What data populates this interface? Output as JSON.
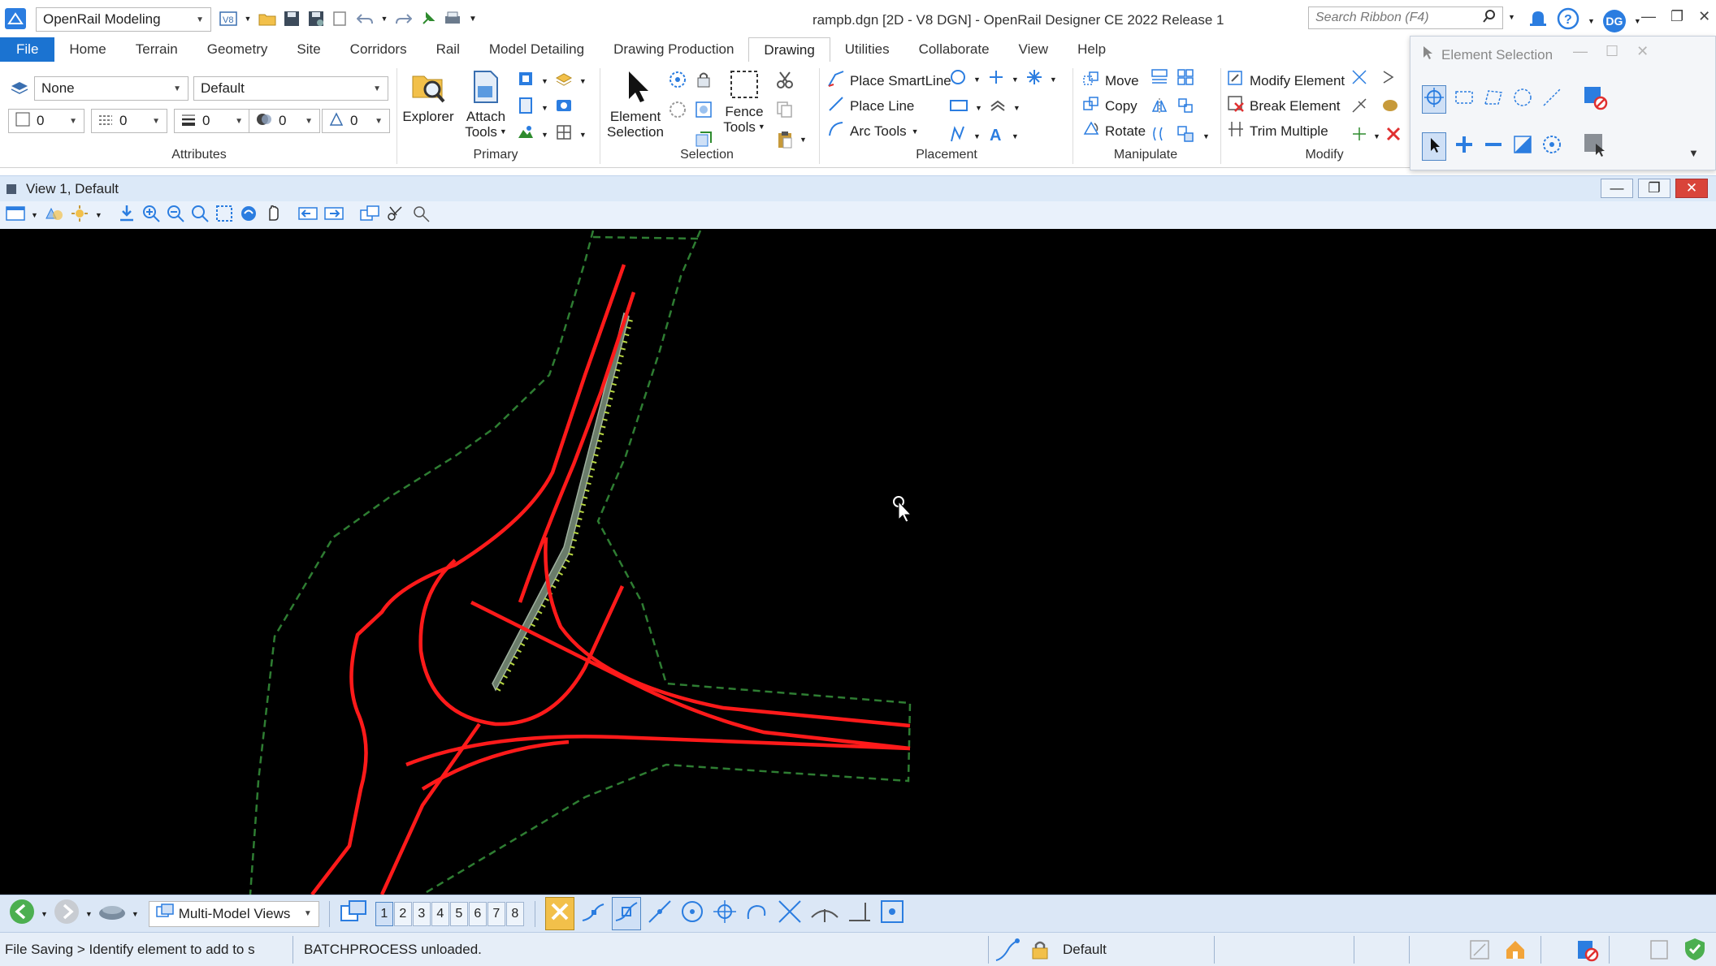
{
  "titlebar": {
    "workflow": "OpenRail Modeling",
    "title": "rampb.dgn [2D - V8 DGN] - OpenRail Designer CE 2022 Release 1",
    "search_placeholder": "Search Ribbon (F4)",
    "user_initials": "DG"
  },
  "tabs": [
    "File",
    "Home",
    "Terrain",
    "Geometry",
    "Site",
    "Corridors",
    "Rail",
    "Model Detailing",
    "Drawing Production",
    "Drawing",
    "Utilities",
    "Collaborate",
    "View",
    "Help"
  ],
  "active_tab": "Drawing",
  "ribbon": {
    "attributes": {
      "level": "None",
      "style": "Default",
      "color": "0",
      "line_style": "0",
      "weight": "0",
      "transparency": "0",
      "priority": "0",
      "label": "Attributes"
    },
    "primary": {
      "explorer": "Explorer",
      "attach_tools_1": "Attach",
      "attach_tools_2": "Tools",
      "label": "Primary"
    },
    "selection": {
      "element_selection_1": "Element",
      "element_selection_2": "Selection",
      "fence_tools_1": "Fence",
      "fence_tools_2": "Tools",
      "label": "Selection"
    },
    "placement": {
      "smartline": "Place SmartLine",
      "line": "Place Line",
      "arc": "Arc Tools",
      "label": "Placement"
    },
    "manipulate": {
      "move": "Move",
      "copy": "Copy",
      "rotate": "Rotate",
      "label": "Manipulate"
    },
    "modify": {
      "modify_element": "Modify Element",
      "break_element": "Break Element",
      "trim_multiple": "Trim Multiple",
      "label": "Modify"
    }
  },
  "element_selection_panel": {
    "title": "Element Selection"
  },
  "view": {
    "title": "View 1, Default"
  },
  "bottom": {
    "view_mode": "Multi-Model Views",
    "view_numbers": [
      "1",
      "2",
      "3",
      "4",
      "5",
      "6",
      "7",
      "8"
    ],
    "active_view": "1"
  },
  "status": {
    "prompt": "File Saving > Identify element to add to s",
    "message": "BATCHPROCESS unloaded.",
    "level": "Default"
  },
  "colors": {
    "file_tab": "#1b73d1",
    "canvas": "#000000",
    "alignment": "#ff1a1a",
    "boundary": "#2e7d32"
  }
}
